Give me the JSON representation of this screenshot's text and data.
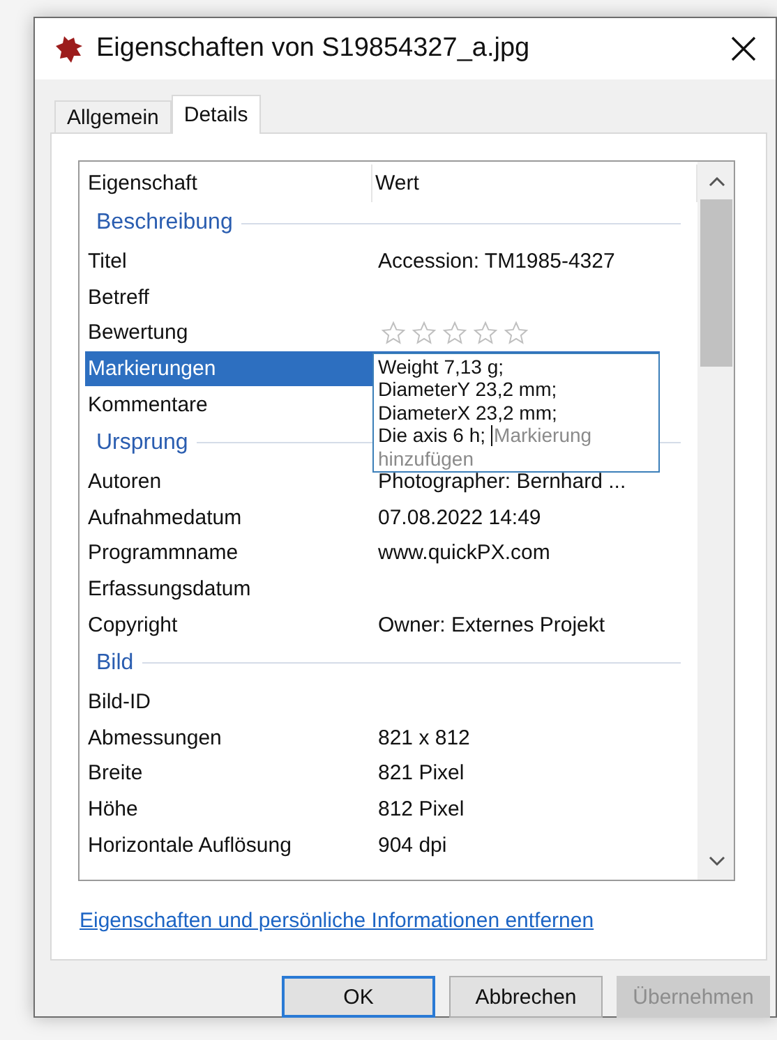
{
  "window": {
    "title": "Eigenschaften von S19854327_a.jpg"
  },
  "tabs": [
    {
      "label": "Allgemein",
      "selected": false
    },
    {
      "label": "Details",
      "selected": true
    }
  ],
  "table": {
    "columns": [
      "Eigenschaft",
      "Wert"
    ],
    "sections": [
      {
        "title": "Beschreibung",
        "rows": [
          {
            "kind": "text",
            "name": "Titel",
            "value": "Accession: TM1985-4327",
            "selected": false
          },
          {
            "kind": "text",
            "name": "Betreff",
            "selected": false
          },
          {
            "kind": "stars",
            "name": "Bewertung",
            "stars": 0,
            "selected": false
          },
          {
            "kind": "tags",
            "name": "Markierungen",
            "selected": true,
            "tags": [
              "Weight 7,13 g;",
              "DiameterY 23,2 mm;",
              "DiameterX 23,2 mm;",
              "Die axis 6 h;"
            ],
            "placeholder": "Markierung hinzufügen"
          },
          {
            "kind": "text",
            "name": "Kommentare",
            "selected": false
          }
        ]
      },
      {
        "title": "Ursprung",
        "rows": [
          {
            "kind": "text",
            "name": "Autoren",
            "value": "Photographer: Bernhard ...",
            "selected": false
          },
          {
            "kind": "text",
            "name": "Aufnahmedatum",
            "value": "07.08.2022 14:49",
            "selected": false
          },
          {
            "kind": "text",
            "name": "Programmname",
            "value": "www.quickPX.com",
            "selected": false
          },
          {
            "kind": "text",
            "name": "Erfassungsdatum",
            "selected": false
          },
          {
            "kind": "text",
            "name": "Copyright",
            "value": "Owner: Externes Projekt",
            "selected": false
          }
        ]
      },
      {
        "title": "Bild",
        "rows": [
          {
            "kind": "text",
            "name": "Bild-ID",
            "selected": false
          },
          {
            "kind": "text",
            "name": "Abmessungen",
            "value": "821 x 812",
            "selected": false
          },
          {
            "kind": "text",
            "name": "Breite",
            "value": "821 Pixel",
            "selected": false
          },
          {
            "kind": "text",
            "name": "Höhe",
            "value": "812 Pixel",
            "selected": false
          },
          {
            "kind": "text",
            "name": "Horizontale Auflösung",
            "value": "904 dpi",
            "selected": false
          }
        ]
      }
    ]
  },
  "link": "Eigenschaften und persönliche Informationen entfernen",
  "buttons": [
    {
      "label": "OK",
      "default": true,
      "disabled": false
    },
    {
      "label": "Abbrechen",
      "default": false,
      "disabled": false
    },
    {
      "label": "Übernehmen",
      "default": false,
      "disabled": true
    }
  ]
}
